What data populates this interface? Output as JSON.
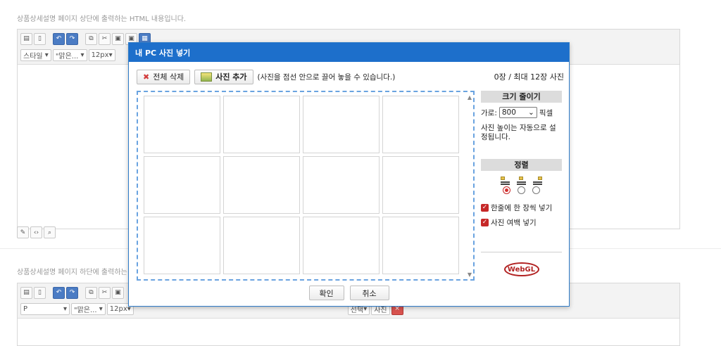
{
  "top_label": "상품상세설명 페이지 상단에 출력하는 HTML 내용입니다.",
  "bottom_label": "상품상세설명 페이지 하단에 출력하는",
  "editor_top": {
    "style_select": "스타일",
    "font_select": "\"맑은...",
    "size_select": "12px"
  },
  "editor_bottom": {
    "para_select": "P",
    "font_select": "\"맑은...",
    "size_select": "12px",
    "frag1": "선택",
    "frag2": "사진"
  },
  "modal": {
    "title": "내 PC 사진 넣기",
    "delete_all": "전체 삭제",
    "add_photo": "사진 추가",
    "hint": "(사진을 점선 안으로 끌어 놓을 수 있습니다.)",
    "count": "0장 / 최대 12장 사진",
    "resize_title": "크기 줄이기",
    "width_label": "가로:",
    "width_value": "800",
    "pixel_unit": "픽셀",
    "height_note": "사진 높이는 자동으로 설정됩니다.",
    "align_title": "정렬",
    "align_selected": 0,
    "one_per_row": "한줄에 한 장씩 넣기",
    "photo_margin": "사진 여백 넣기",
    "logo": "WebGL",
    "ok": "확인",
    "cancel": "취소"
  },
  "colors": {
    "header_blue": "#1d6fcb",
    "dashed_border": "#6aa3e0",
    "check_red": "#c62828"
  }
}
